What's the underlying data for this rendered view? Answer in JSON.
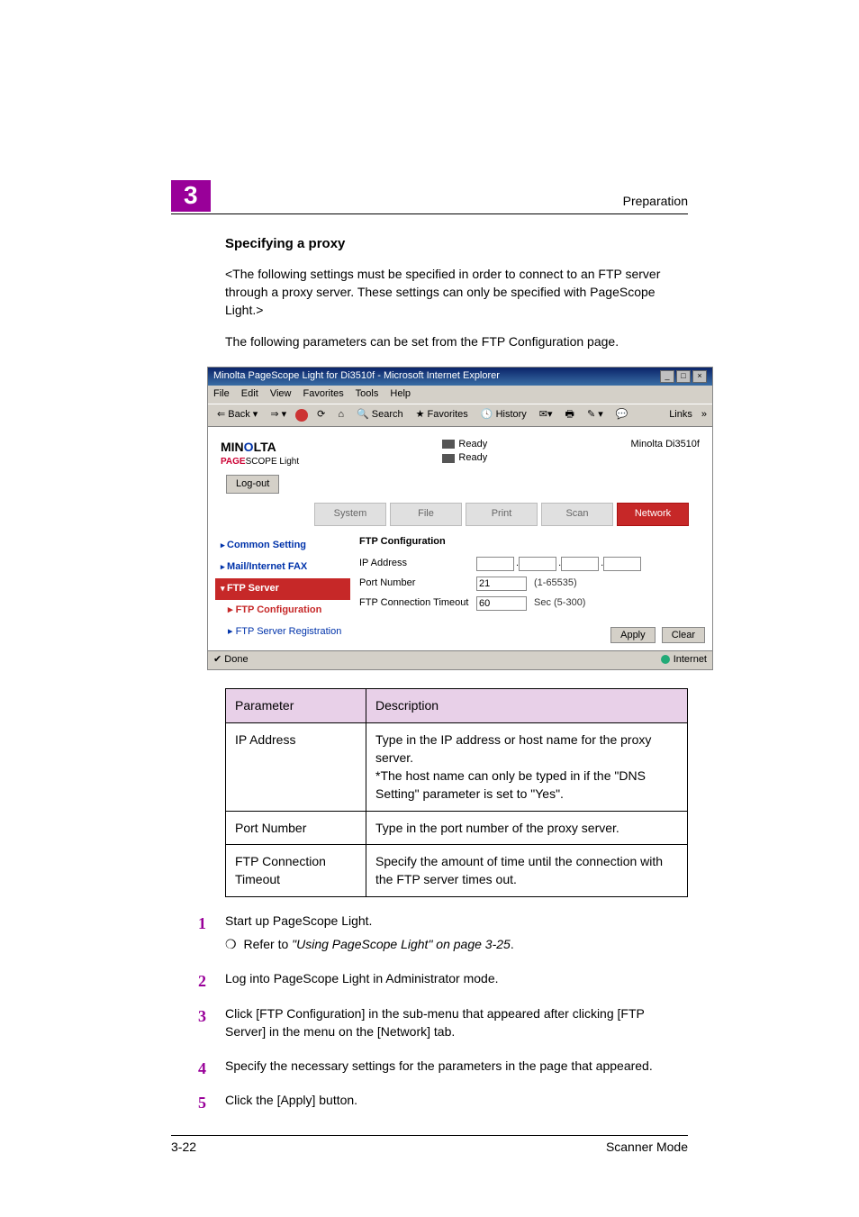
{
  "chapter": {
    "num": "3",
    "title": "Preparation"
  },
  "section_heading": "Specifying a proxy",
  "intro1": "<The following settings must be specified in order to connect to an FTP server through a proxy server. These settings can only be specified with PageScope Light.>",
  "intro2": "The following parameters can be set from the FTP Configuration page.",
  "ie": {
    "title": "Minolta PageScope Light for Di3510f - Microsoft Internet Explorer",
    "menus": [
      "File",
      "Edit",
      "View",
      "Favorites",
      "Tools",
      "Help"
    ],
    "toolbar": {
      "back": "Back",
      "search": "Search",
      "favorites": "Favorites",
      "history": "History"
    },
    "links": "Links",
    "status_left": "Done",
    "status_right": "Internet"
  },
  "psl": {
    "brand": "MINOLTA",
    "brand_sub1": "PAGE",
    "brand_sub2": "SCOPE",
    "brand_sub3": "Light",
    "ready": "Ready",
    "model": "Minolta Di3510f",
    "logout": "Log-out",
    "tabs": [
      "System",
      "File",
      "Print",
      "Scan",
      "Network"
    ],
    "side": {
      "common": "Common Setting",
      "mail": "Mail/Internet FAX",
      "ftp_server": "FTP Server",
      "ftp_config": "FTP Configuration",
      "ftp_reg": "FTP Server Registration"
    },
    "form": {
      "title": "FTP Configuration",
      "ip_label": "IP Address",
      "port_label": "Port Number",
      "port_value": "21",
      "port_hint": "(1-65535)",
      "timeout_label": "FTP Connection Timeout",
      "timeout_value": "60",
      "timeout_hint": "Sec (5-300)",
      "apply": "Apply",
      "clear": "Clear"
    }
  },
  "param_table": {
    "headers": [
      "Parameter",
      "Description"
    ],
    "rows": [
      [
        "IP Address",
        "Type in the IP address or host name for the proxy server.\n*The host name can only be typed in if the \"DNS Setting\" parameter is set to \"Yes\"."
      ],
      [
        "Port Number",
        "Type in the port number of the proxy server."
      ],
      [
        "FTP Connection Timeout",
        "Specify the amount of time until the connection with the FTP server times out."
      ]
    ]
  },
  "steps": {
    "s1": "Start up PageScope Light.",
    "s1_sub_prefix": "Refer to ",
    "s1_sub_em": "\"Using PageScope Light\" on page 3-25",
    "s1_sub_suffix": ".",
    "s2": "Log into PageScope Light in Administrator mode.",
    "s3": "Click [FTP Configuration] in the sub-menu that appeared after clicking [FTP Server] in the menu on the [Network] tab.",
    "s4": "Specify the necessary settings for the parameters in the page that appeared.",
    "s5": "Click the [Apply] button."
  },
  "footer": {
    "left": "3-22",
    "right": "Scanner Mode"
  }
}
